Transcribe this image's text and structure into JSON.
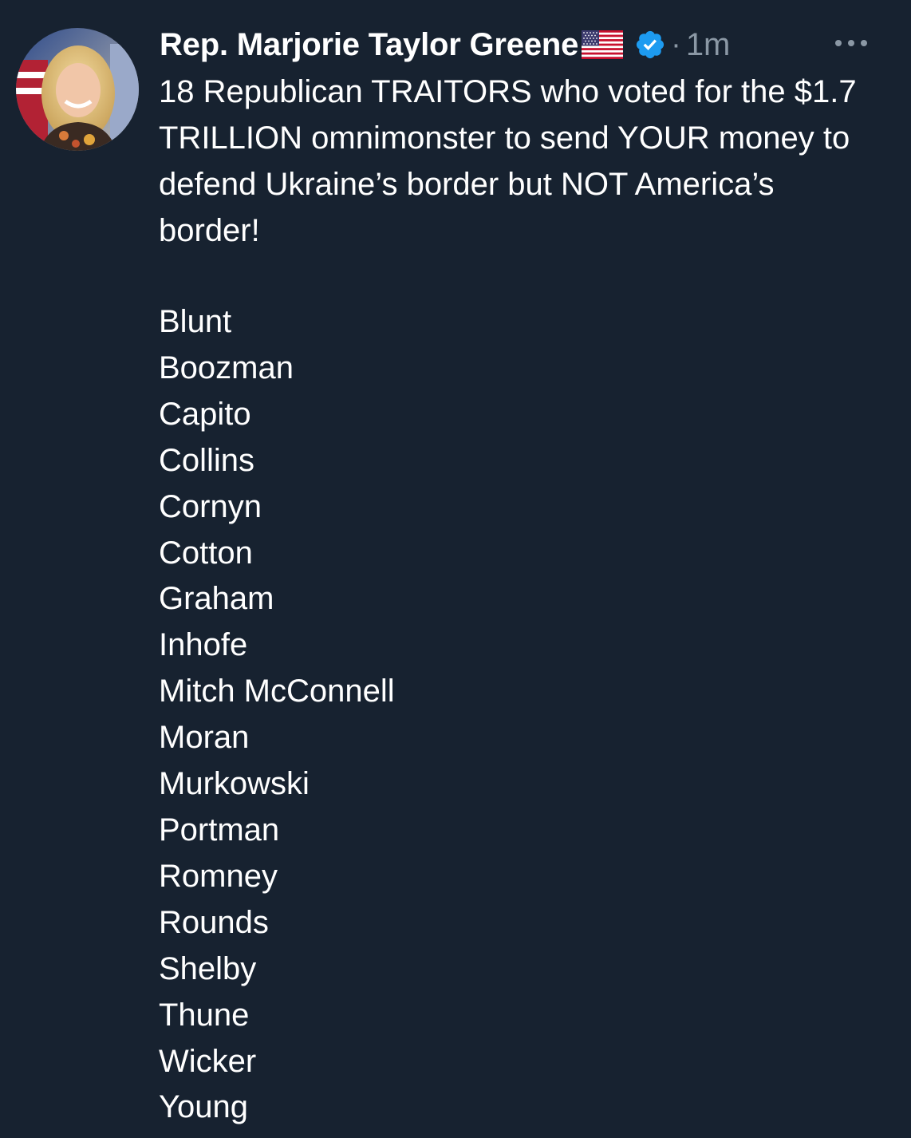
{
  "tweet": {
    "author": {
      "display_name": "Rep. Marjorie Taylor Greene",
      "flag_emoji": "🇺🇸",
      "verified": true,
      "avatar_icon": "avatar-photo"
    },
    "separator": "·",
    "timestamp": "1m",
    "more_icon": "more-horizontal-icon",
    "text": "18 Republican TRAITORS who voted for the $1.7 TRILLION omnimonster to send YOUR money to defend Ukraine’s border but NOT America’s border!",
    "names": [
      "Blunt",
      "Boozman",
      "Capito",
      "Collins",
      "Cornyn",
      "Cotton",
      "Graham",
      "Inhofe",
      "Mitch McConnell",
      "Moran",
      "Murkowski",
      "Portman",
      "Romney",
      "Rounds",
      "Shelby",
      "Thune",
      "Wicker",
      "Young"
    ]
  },
  "colors": {
    "background": "#172230",
    "text": "#ffffff",
    "secondary_text": "#8b98a5",
    "verified_blue": "#1d9bf0"
  }
}
